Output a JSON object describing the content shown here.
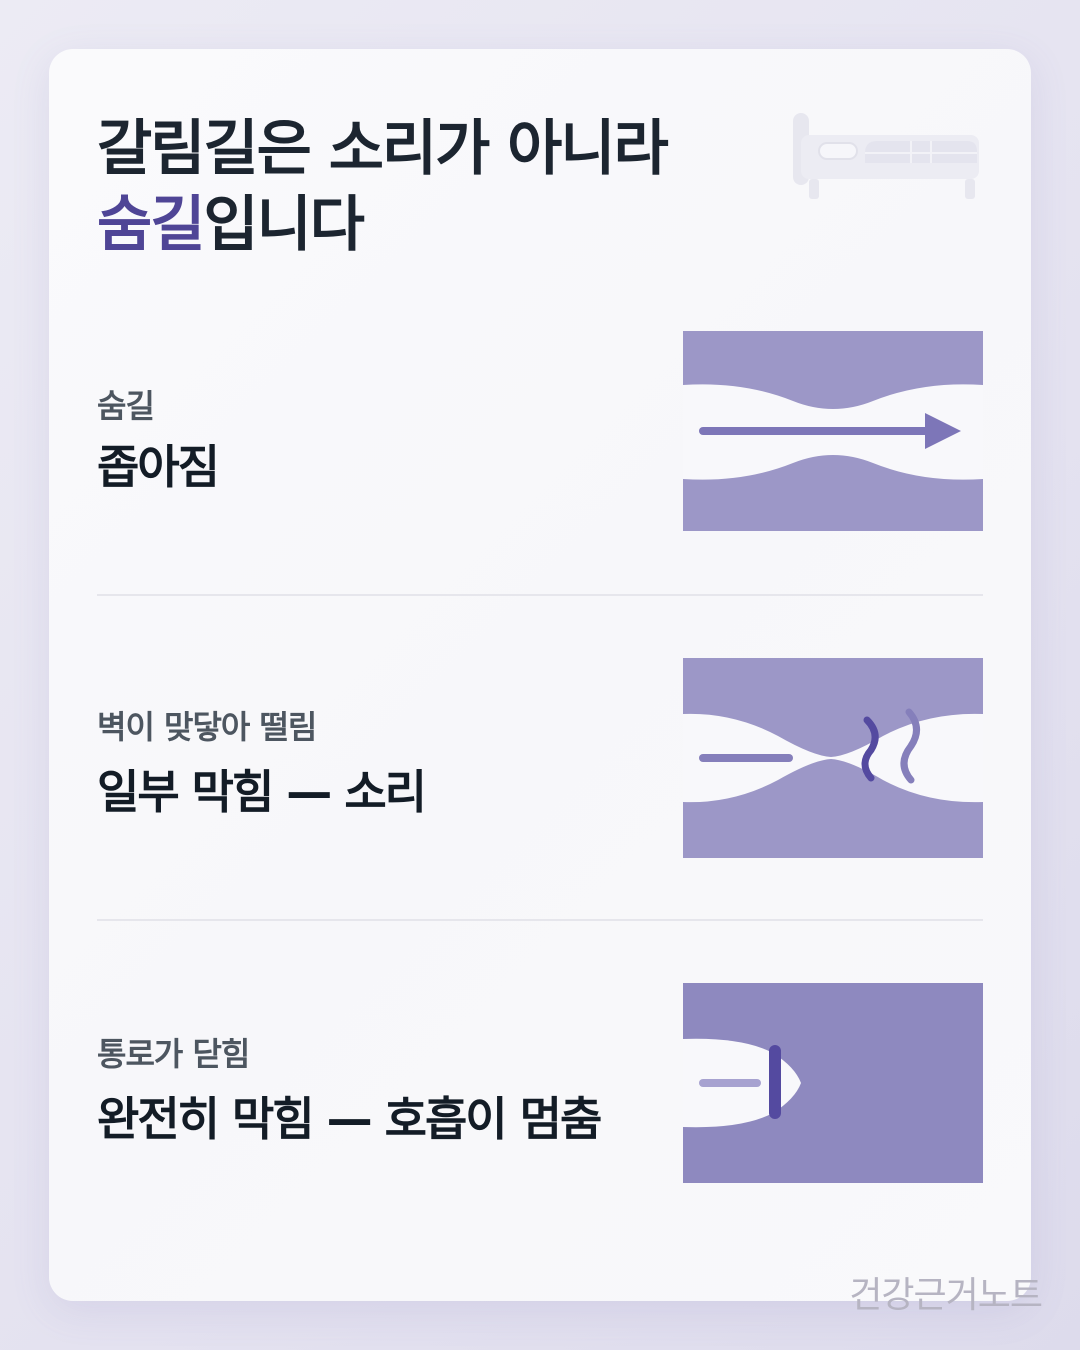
{
  "title": {
    "line1": "갈림길은 소리가 아니라",
    "line2_accent": "숨길",
    "line2_rest": "입니다"
  },
  "icons": {
    "header": "bed-icon"
  },
  "rows": [
    {
      "sub": "숨길",
      "main": "좁아짐",
      "illustration": "narrowed-airway-icon"
    },
    {
      "sub": "벽이 맞닿아 떨림",
      "main": "일부 막힘 — 소리",
      "illustration": "partial-blockage-vibration-icon"
    },
    {
      "sub": "통로가 닫힘",
      "main": "완전히 막힘 — 호흡이 멈춤",
      "illustration": "full-blockage-icon"
    }
  ],
  "colors": {
    "accent": "#4f4596",
    "illustration_fill": "#9c97c7",
    "illustration_fill_dark": "#8e89bf",
    "arrow": "#7d76b8",
    "wave": "#544aa0",
    "text_dark": "#131c26",
    "text_sub": "#4d5660"
  },
  "watermark": "건강근거노트"
}
